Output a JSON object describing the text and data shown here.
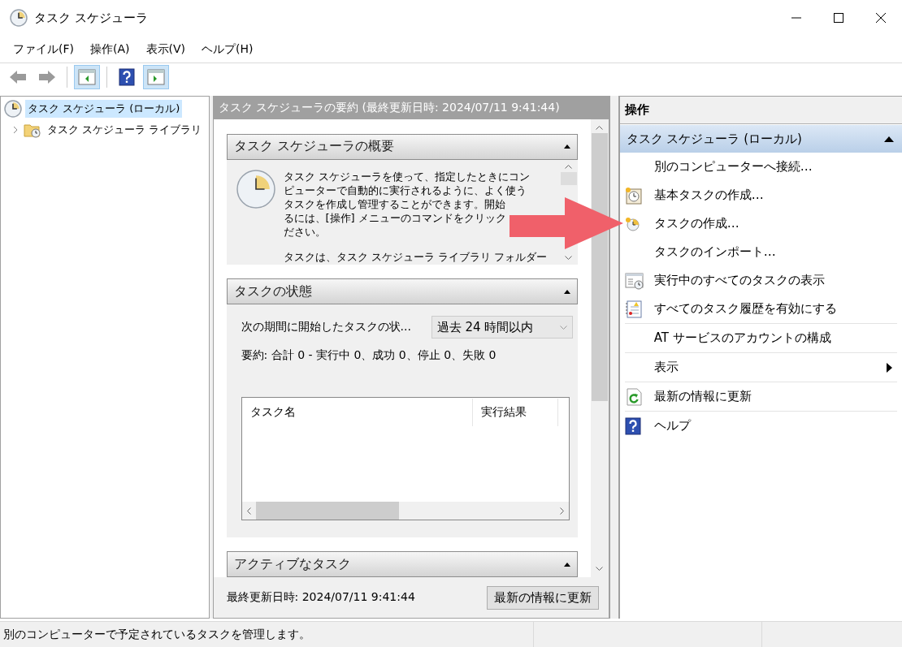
{
  "window": {
    "title": "タスク スケジューラ"
  },
  "menu": [
    "ファイル(F)",
    "操作(A)",
    "表示(V)",
    "ヘルプ(H)"
  ],
  "toolbar": [
    {
      "kind": "back",
      "disabled": true
    },
    {
      "kind": "forward",
      "disabled": true
    },
    {
      "kind": "tree",
      "selected": true
    },
    {
      "kind": "help",
      "selected": false
    },
    {
      "kind": "actions",
      "selected": true
    }
  ],
  "tree": [
    {
      "label": "タスク スケジューラ (ローカル)",
      "selected": true,
      "children": [
        {
          "label": "タスク スケジューラ ライブラリ",
          "selected": false,
          "expanded": false
        }
      ]
    }
  ],
  "summary": {
    "title": "タスク スケジューラの要約 (最終更新日時: 2024/07/11 9:41:44)",
    "sections": [
      {
        "kind": "overview",
        "title": "タスク スケジューラの概要",
        "expanded": true,
        "paragraphs": [
          [
            "タスク スケジューラを使って、指定したときにコン",
            "ピューターで自動的に実行されるように、よく使う",
            "タスクを作成し管理することができます。開始",
            "るには、[操作] メニューのコマンドをクリック",
            "ださい。"
          ],
          [
            "タスクは、タスク スケジューラ ライブラリ フォルダー"
          ]
        ]
      },
      {
        "kind": "status",
        "title": "タスクの状態",
        "expanded": true,
        "filter_label": "次の期間に開始したタスクの状...",
        "filter_value": "過去 24 時間以内",
        "totals": "要約: 合計 0 - 実行中 0、成功 0、停止 0、失敗 0",
        "columns": [
          "タスク名",
          "実行結果"
        ]
      },
      {
        "kind": "active",
        "title": "アクティブなタスク",
        "expanded": true
      }
    ],
    "last_updated": "最終更新日時: 2024/07/11 9:41:44",
    "refresh_button": "最新の情報に更新"
  },
  "actions": {
    "title": "操作",
    "group": {
      "label": "タスク スケジューラ (ローカル)",
      "expanded": true
    },
    "groups": [
      [
        {
          "label": "別のコンピューターへ接続…",
          "submenu": false
        },
        {
          "label": "基本タスクの作成…",
          "submenu": false
        },
        {
          "label": "タスクの作成…",
          "submenu": false
        },
        {
          "label": "タスクのインポート…",
          "submenu": false
        },
        {
          "label": "実行中のすべてのタスクの表示",
          "submenu": false
        },
        {
          "label": "すべてのタスク履歴を有効にする",
          "submenu": false
        }
      ],
      [
        {
          "label": "AT サービスのアカウントの構成",
          "submenu": false
        }
      ],
      [
        {
          "label": "表示",
          "submenu": true
        }
      ],
      [
        {
          "label": "最新の情報に更新",
          "submenu": false
        }
      ],
      [
        {
          "label": "ヘルプ",
          "submenu": false
        }
      ]
    ]
  },
  "status_bar": "別のコンピューターで予定されているタスクを管理します。"
}
